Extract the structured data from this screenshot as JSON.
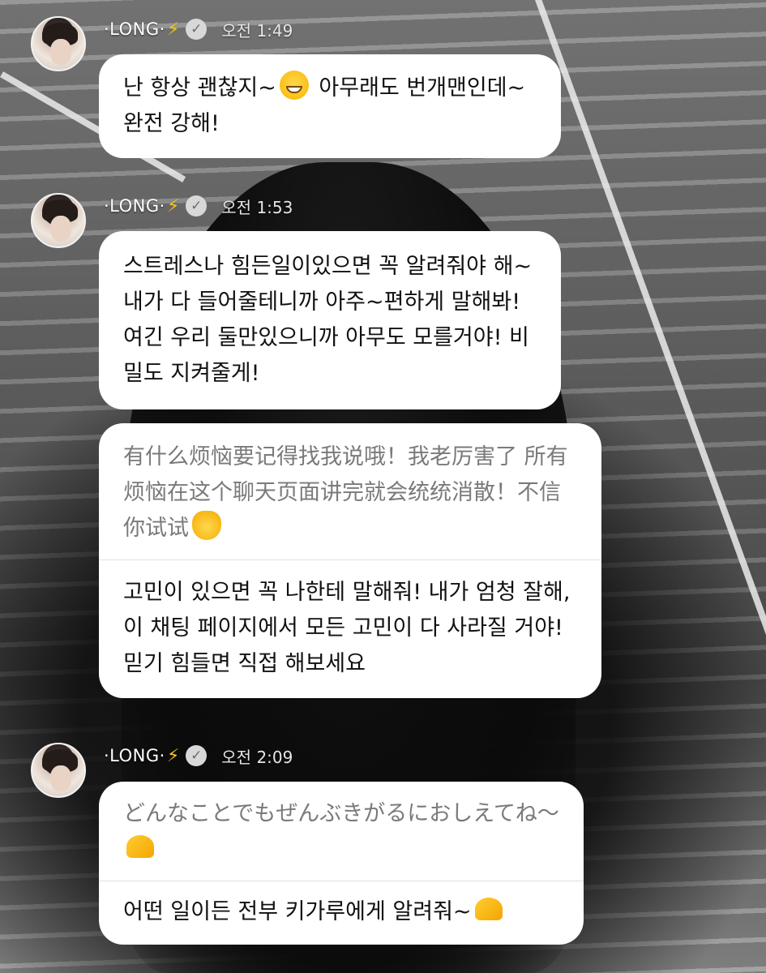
{
  "messages": [
    {
      "sender": "·LONG·",
      "bolt": "⚡",
      "verified_icon": "verified-check-icon",
      "time": "오전 1:49",
      "bubbles": [
        {
          "text": "난 항상 괜찮지~",
          "emoji": "grinning-face-icon",
          "text_after": " 아무래도 번개맨인데~완전 강해!"
        }
      ]
    },
    {
      "sender": "·LONG·",
      "bolt": "⚡",
      "verified_icon": "verified-check-icon",
      "time": "오전 1:53",
      "bubbles": [
        {
          "text": "스트레스나 힘든일이있으면 꼭 알려줘야 해~내가 다 들어줄테니까 아주~편하게 말해봐! 여긴 우리 둘만있으니까 아무도 모를거야! 비밀도 지켜줄게!"
        }
      ],
      "translated_bubble": {
        "original": "有什么烦恼要记得找我说哦！我老厉害了 所有烦恼在这个聊天页面讲完就会统统消散！不信你试试",
        "original_emoji": "grinning-cat-icon",
        "translation": "고민이 있으면 꼭 나한테 말해줘! 내가 엄청 잘해, 이 채팅 페이지에서 모든 고민이 다 사라질 거야! 믿기 힘들면 직접 해보세요"
      }
    },
    {
      "sender": "·LONG·",
      "bolt": "⚡",
      "verified_icon": "verified-check-icon",
      "time": "오전 2:09",
      "translated_bubble": {
        "original": "どんなことでもぜんぶきがるにおしえてね～",
        "original_emoji": "heart-hands-icon",
        "translation": "어떤 일이든 전부 키가루에게 알려줘~",
        "translation_emoji": "heart-hands-icon"
      }
    }
  ]
}
